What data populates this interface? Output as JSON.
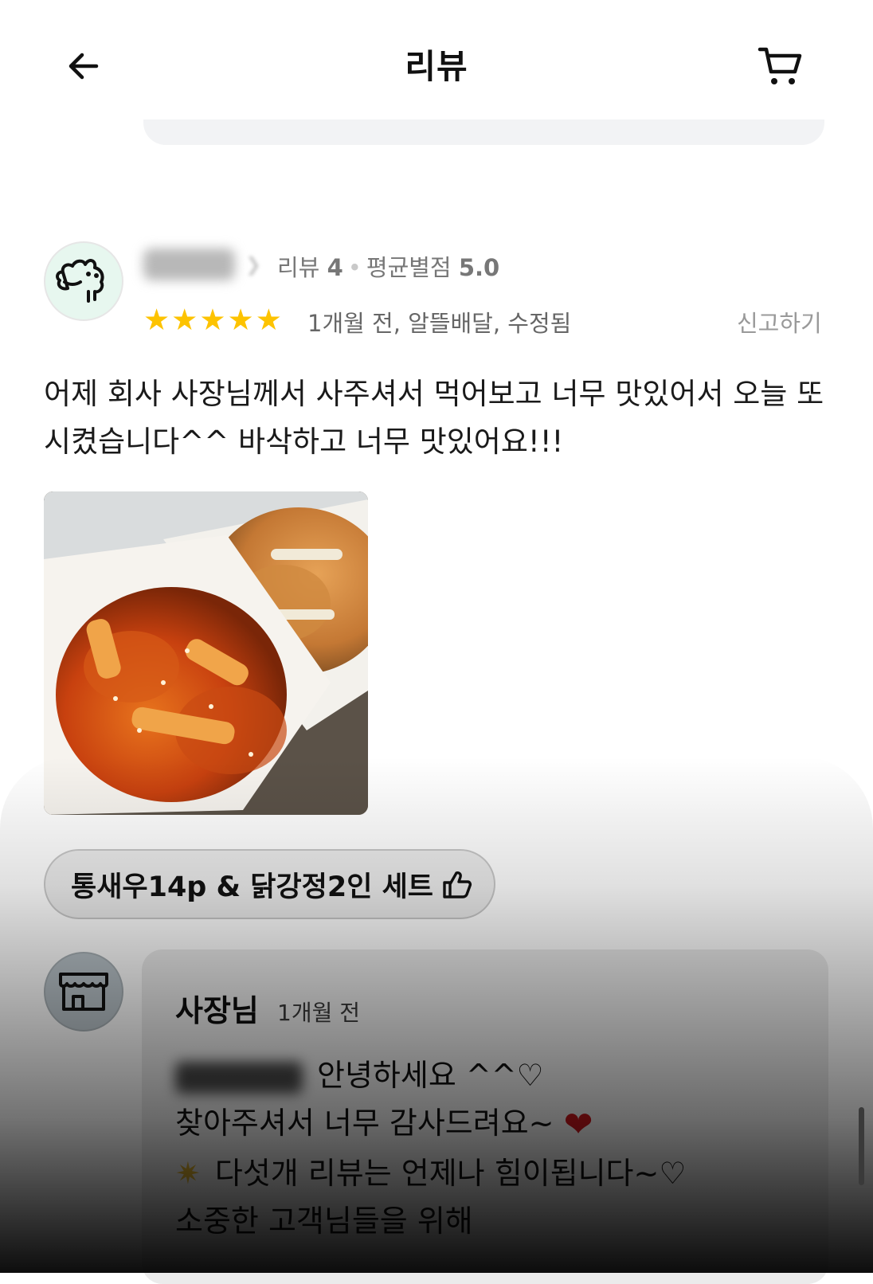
{
  "header": {
    "title": "리뷰",
    "back_icon": "arrow-left-icon",
    "cart_icon": "cart-icon"
  },
  "review": {
    "reviewer": {
      "avatar_icon": "doodle-character-icon",
      "meta_review_label": "리뷰",
      "review_count": "4",
      "meta_avg_label": "평균별점",
      "avg_rating": "5.0"
    },
    "stars": 5,
    "info": "1개월 전, 알뜰배달, 수정됨",
    "report_label": "신고하기",
    "text": "어제 회사 사장님께서 사주셔서 먹어보고 너무 맛있어서 오늘 또 시켰습니다^^ 바삭하고 너무 맛있어요!!!",
    "menu_chip": {
      "label": "통새우14p & 닭강정2인 세트",
      "icon": "thumbs-up-icon"
    }
  },
  "reply": {
    "avatar_icon": "store-icon",
    "owner_label": "사장님",
    "time": "1개월 전",
    "line1": "안녕하세요 ^^♡",
    "line2": "찾아주셔서 너무 감사드려요~",
    "line3": "다섯개 리뷰는 언제나 힘이됩니다~♡",
    "line4": "소중한 고객님들을 위해"
  },
  "colors": {
    "star": "#fdc300",
    "heart": "#c2151b",
    "avatar_bg": "#e7f7ef"
  }
}
